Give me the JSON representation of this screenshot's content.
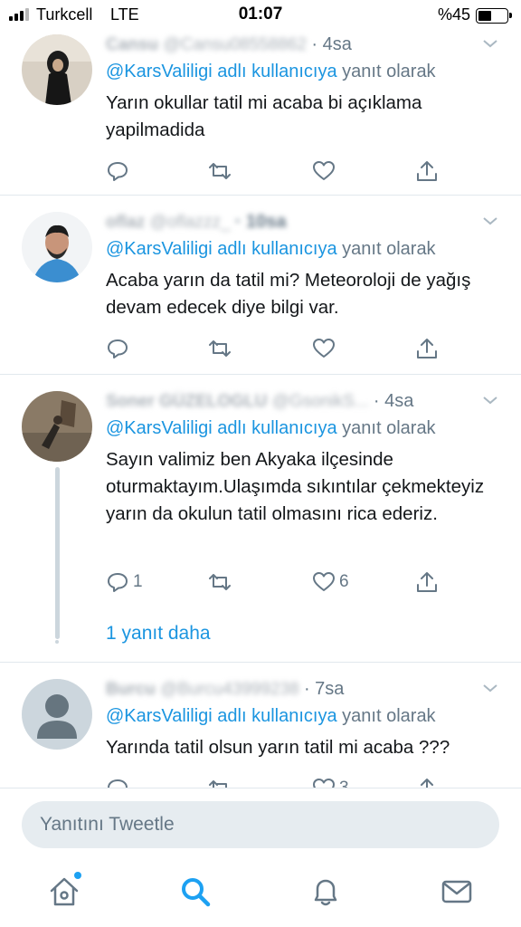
{
  "status_bar": {
    "carrier": "Turkcell",
    "network": "LTE",
    "time": "01:07",
    "battery": "%45",
    "battery_level": 0.45
  },
  "tweets": [
    {
      "name": "Cansu",
      "handle": "@Cansu08558862",
      "time": "· 4sa",
      "avatar_icon": "user-photo-avatar",
      "reply_to_mention": "@KarsValiligi adlı kullanıcıya",
      "reply_to_suffix": "yanıt olarak",
      "text": "Yarın okullar tatil mi acaba bi açıklama yapilmadida",
      "reply_count": "",
      "like_count": ""
    },
    {
      "name": "oflaz",
      "handle": "@oflazzz_",
      "time": "· 10sa",
      "avatar_icon": "user-photo-avatar",
      "reply_to_mention": "@KarsValiligi adlı kullanıcıya",
      "reply_to_suffix": "yanıt olarak",
      "text": "Acaba yarın da tatil mi? Meteoroloji de yağış devam edecek diye bilgi var.",
      "reply_count": "",
      "like_count": ""
    },
    {
      "name": "Soner GÜZELOGLU",
      "handle": "@GsonikS...",
      "time": "· 4sa",
      "avatar_icon": "user-photo-avatar",
      "reply_to_mention": "@KarsValiligi adlı kullanıcıya",
      "reply_to_suffix": "yanıt olarak",
      "text": "Sayın valimiz ben Akyaka ilçesinde oturmaktayım.Ulaşımda sıkıntılar çekmekteyiz yarın da okulun tatil olmasını rica ederiz.",
      "reply_count": "1",
      "like_count": "6",
      "more_replies": "1 yanıt daha"
    },
    {
      "name": "Burcu",
      "handle": "@Burcu43999238",
      "time": "· 7sa",
      "avatar_icon": "default-user-avatar",
      "reply_to_mention": "@KarsValiligi adlı kullanıcıya",
      "reply_to_suffix": "yanıt olarak",
      "text": "Yarında tatil olsun yarın tatil mi acaba ???",
      "reply_count": "",
      "like_count": "3"
    }
  ],
  "composer": {
    "placeholder": "Yanıtını Tweetle"
  },
  "tab_bar": {
    "items": [
      "home-icon",
      "search-icon",
      "notifications-icon",
      "messages-icon"
    ],
    "accent_color": "#1da1f2"
  },
  "colors": {
    "link": "#1b95e0",
    "secondary_text": "#657786",
    "divider": "#e1e8ed"
  }
}
